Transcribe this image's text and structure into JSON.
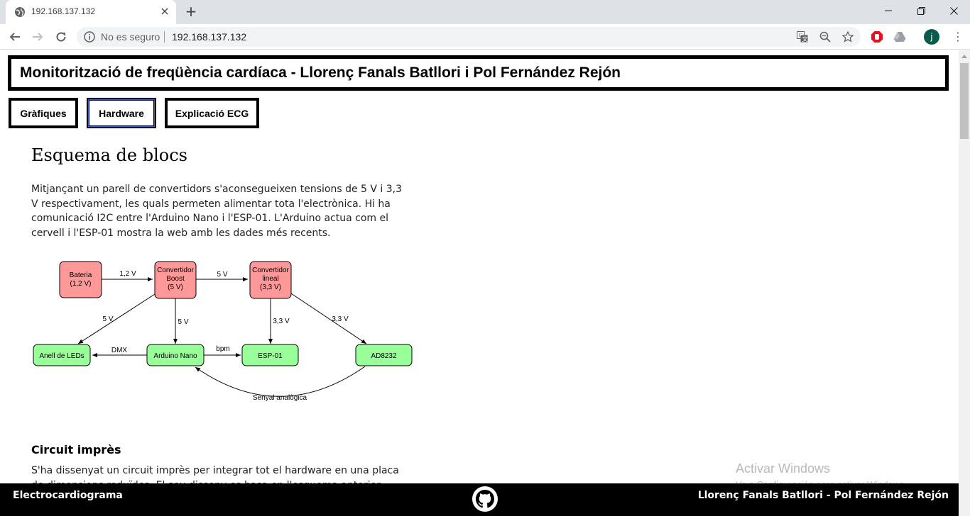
{
  "browser": {
    "tab_title": "192.168.137.132",
    "security_label": "No es seguro",
    "url": "192.168.137.132",
    "profile_initial": "j",
    "icons": [
      "globe-icon",
      "close-icon",
      "plus-icon",
      "minimize-icon",
      "restore-icon",
      "back-icon",
      "forward-icon",
      "reload-icon",
      "info-icon",
      "translate-icon",
      "zoom-icon",
      "star-icon",
      "stop-extension-icon",
      "drive-icon",
      "menu-dots-icon"
    ]
  },
  "page": {
    "title": "Monitorització de freqüència cardíaca - Llorenç Fanals Batllori i Pol Fernández Rejón",
    "nav": [
      {
        "label": "Gràfiques",
        "active": false
      },
      {
        "label": "Hardware",
        "active": true
      },
      {
        "label": "Explicació ECG",
        "active": false
      }
    ],
    "section_heading": "Esquema de blocs",
    "intro_text": "Mitjançant un parell de convertidors s'aconsegueixen tensions de 5 V i 3,3 V respectivament, les quals permeten alimentar tota l'electrònica. Hi ha comunicació I2C entre l'Arduino Nano i l'ESP-01. L'Arduino actua com el cervell i l'ESP-01 mostra la web amb les dades més recents.",
    "diagram": {
      "nodes": {
        "bateria": [
          "Bateria",
          "(1,2 V)"
        ],
        "boost": [
          "Convertidor",
          "Boost",
          "(5 V)"
        ],
        "lineal": [
          "Convertidor",
          "lineal",
          "(3,3 V)"
        ],
        "leds": [
          "Anell de LEDs"
        ],
        "arduino": [
          "Arduino Nano"
        ],
        "esp": [
          "ESP-01"
        ],
        "ad": [
          "AD8232"
        ]
      },
      "edges": {
        "bat_boost": "1,2 V",
        "boost_lineal": "5 V",
        "boost_leds": "5 V",
        "boost_arduino": "5 V",
        "lineal_esp": "3,3 V",
        "lineal_ad": "3,3 V",
        "arduino_leds": "DMX",
        "arduino_esp": "bpm",
        "ad_arduino": "Senyal analògica"
      },
      "colors": {
        "power": "#ff9999",
        "device": "#99ff99"
      }
    },
    "sub_heading": "Circuit imprès",
    "circuit_text": "S'ha dissenyat un circuit imprès per integrar tot el hardware en una placa de dimensions reduïdes. El seu disseny es basa en l'esquema anterior."
  },
  "footer": {
    "left": "Electrocardiograma",
    "right": "Llorenç Fanals Batllori - Pol Fernández Rejón",
    "icon": "github-icon"
  },
  "overlay": {
    "watermark_title": "Activar Windows",
    "watermark_sub": "Ve a Configuración para activar Windows."
  }
}
